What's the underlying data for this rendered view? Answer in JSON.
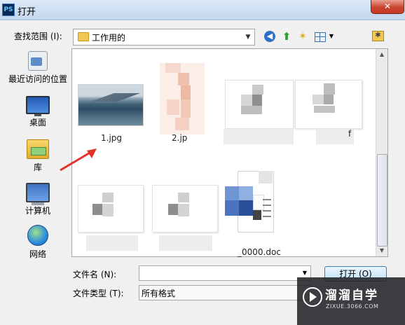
{
  "window": {
    "app_icon": "PS",
    "title": "打开",
    "close_label": "✕"
  },
  "toolbar": {
    "lookin_label": "查找范围 (I):",
    "lookin_value": "工作用的",
    "dropdown_arrow": "▼",
    "back_icon": "back-arrow-icon",
    "up_icon": "up-folder-icon",
    "new_folder_icon": "new-folder-icon",
    "view_menu_icon": "view-menu-icon",
    "favorites_icon": "favorites-folder-icon"
  },
  "places": [
    {
      "label": "最近访问的位置",
      "icon": "recent-places-icon"
    },
    {
      "label": "桌面",
      "icon": "desktop-icon"
    },
    {
      "label": "库",
      "icon": "libraries-icon"
    },
    {
      "label": "计算机",
      "icon": "computer-icon"
    },
    {
      "label": "网络",
      "icon": "network-icon"
    }
  ],
  "files": [
    {
      "label": "1.jpg"
    },
    {
      "label": "2.jp"
    },
    {
      "label": "f"
    },
    {
      "label": "_0000.doc"
    }
  ],
  "form": {
    "filename_label": "文件名 (N):",
    "filename_value": "",
    "filetype_label": "文件类型 (T):",
    "filetype_value": "所有格式",
    "open_label": "打开 (O)",
    "select_arrow": "▼"
  },
  "watermark": {
    "title": "溜溜自学",
    "url": "ZIXUE.3066.COM"
  },
  "colors": {
    "annotation_arrow": "#e0322a",
    "title_bar": "#c4d6ee",
    "close_button": "#c94430"
  }
}
